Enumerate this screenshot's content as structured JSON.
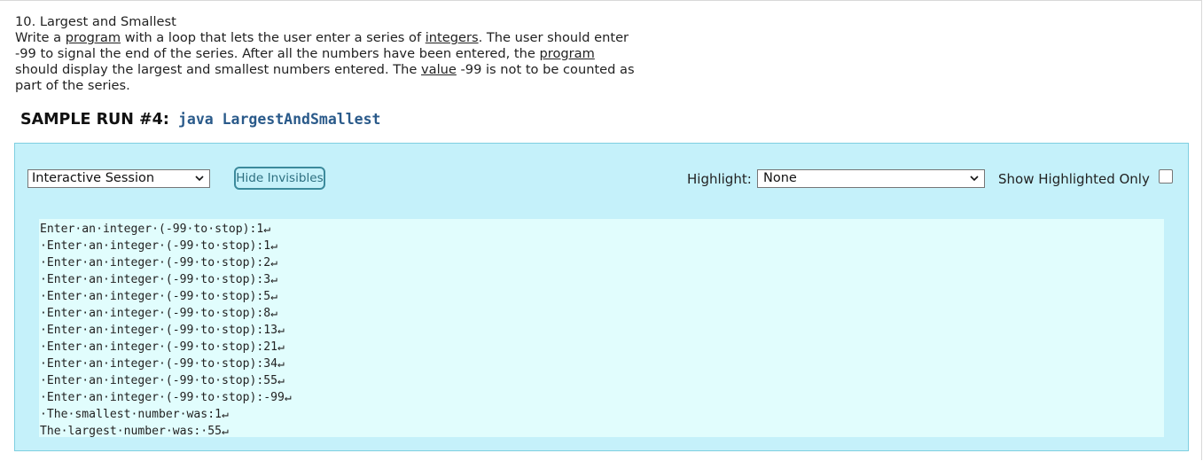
{
  "problem": {
    "title": "10. Largest and Smallest",
    "description_segments": [
      {
        "text": "Write a ",
        "u": false
      },
      {
        "text": "program",
        "u": true
      },
      {
        "text": " with a loop that lets the user enter a series of ",
        "u": false
      },
      {
        "text": "integers",
        "u": true
      },
      {
        "text": ". The user should enter -99 to signal the end of the series. After all the numbers have been entered, the ",
        "u": false
      },
      {
        "text": "program",
        "u": true
      },
      {
        "text": " should display the largest and smallest numbers entered. The ",
        "u": false
      },
      {
        "text": "value",
        "u": true
      },
      {
        "text": " -99 is not to be counted as part of the series.",
        "u": false
      }
    ]
  },
  "sample_run": {
    "label": "SAMPLE RUN #4:",
    "command": "java LargestAndSmallest"
  },
  "toolbar": {
    "session_select_value": "Interactive Session",
    "hide_invisibles_label": "Hide Invisibles",
    "highlight_label": "Highlight:",
    "highlight_select_value": "None",
    "show_highlighted_only_label": "Show Highlighted Only",
    "show_highlighted_only_checked": false
  },
  "output": {
    "lines": [
      "Enter·an·integer·(-99·to·stop):1↵",
      "·Enter·an·integer·(-99·to·stop):1↵",
      "·Enter·an·integer·(-99·to·stop):2↵",
      "·Enter·an·integer·(-99·to·stop):3↵",
      "·Enter·an·integer·(-99·to·stop):5↵",
      "·Enter·an·integer·(-99·to·stop):8↵",
      "·Enter·an·integer·(-99·to·stop):13↵",
      "·Enter·an·integer·(-99·to·stop):21↵",
      "·Enter·an·integer·(-99·to·stop):34↵",
      "·Enter·an·integer·(-99·to·stop):55↵",
      "·Enter·an·integer·(-99·to·stop):-99↵",
      "·The·smallest·number·was:1↵",
      "The·largest·number·was:·55↵"
    ]
  },
  "colors": {
    "panel_bg": "#c5f1fa",
    "output_bg": "#e1fdfd",
    "command_color": "#2a5a8a",
    "button_border": "#3c8a9c"
  }
}
